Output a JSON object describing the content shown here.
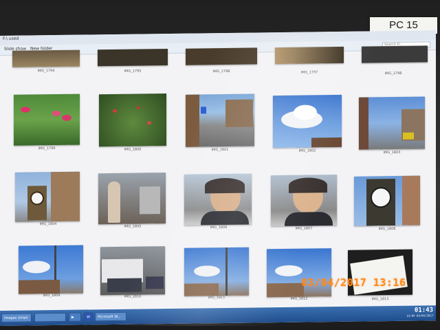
{
  "monitor": {
    "label": "PC 15"
  },
  "window": {
    "title": "F:\\ used",
    "toolbar": {
      "slide_show": "Slide show",
      "new_folder": "New folder",
      "search_placeholder": "Search Fi..."
    }
  },
  "rows": [
    {
      "captions": [
        "IMG_1794",
        "IMG_1795",
        "IMG_1796",
        "IMG_1797",
        "IMG_1798"
      ]
    },
    {
      "captions": [
        "IMG_1799",
        "IMG_1800",
        "IMG_1801",
        "IMG_1802",
        "IMG_1803"
      ]
    },
    {
      "captions": [
        "IMG_1804",
        "IMG_1805",
        "IMG_1806",
        "IMG_1807",
        "IMG_1808"
      ]
    },
    {
      "captions": [
        "IMG_1809",
        "IMG_1810",
        "IMG_1811",
        "IMG_1812",
        "IMG_1813"
      ]
    }
  ],
  "taskbar": {
    "items": [
      "Images (Intel)",
      "",
      "",
      "Microsoft W..."
    ],
    "clock": "01:43",
    "clock_sub": "13:04 03/04/2017"
  },
  "camera_timestamp": "03/04/2017  13:16",
  "colors": {
    "stamp": "#ff8a1c",
    "taskbar": "#2a5ea0"
  }
}
